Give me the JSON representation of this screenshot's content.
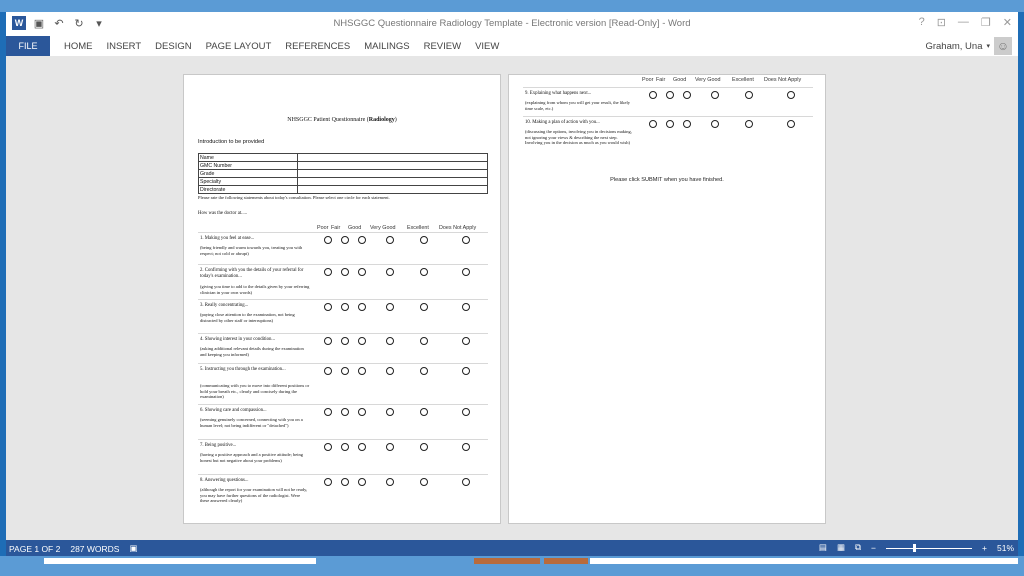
{
  "window": {
    "title": "NHSGGC Questionnaire Radiology Template - Electronic version [Read-Only] - Word",
    "controls": [
      "?",
      "⊡",
      "—",
      "❐",
      "✕"
    ]
  },
  "ribbon": {
    "file": "FILE",
    "tabs": [
      "HOME",
      "INSERT",
      "DESIGN",
      "PAGE LAYOUT",
      "REFERENCES",
      "MAILINGS",
      "REVIEW",
      "VIEW"
    ],
    "user": "Graham, Una"
  },
  "document": {
    "title_prefix": "NHSGGC Patient Questionnaire (",
    "title_bold": "Radiology",
    "title_suffix": ")",
    "intro": "Introduction to be provided",
    "info_fields": [
      "Name",
      "GMC Number",
      "Grade",
      "Specialty",
      "Directorate"
    ],
    "instructions": "Please rate the following statements about today's consultation.  Please select one circle for each statement.",
    "how_was": "How was the doctor at.....",
    "columns": [
      "Poor",
      "Fair",
      "Good",
      "Very Good",
      "Excellent",
      "Does Not Apply"
    ],
    "questions": [
      {
        "text": "1. Making you feel at ease...",
        "sub": "(being friendly and warm towards you, treating you with respect; not cold or abrupt)"
      },
      {
        "text": "2. Confirming with you the details of your referral for today's examination...",
        "sub": "(giving you time to add to the details given by your referring clinician in your own words)"
      },
      {
        "text": "3. Really concentrating...",
        "sub": "(paying close attention to the examination, not being distracted by other staff or interruptions)"
      },
      {
        "text": "4. Showing interest in your condition...",
        "sub": "(asking additional relevant details during the examination and keeping you informed)"
      },
      {
        "text": "5. Instructing you through the examination...",
        "sub": "(communicating with you to move into different positions or hold your breath etc., clearly and concisely during the examination)"
      },
      {
        "text": "6. Showing care and compassion...",
        "sub": "(seeming genuinely concerned, connecting with you on a human level; not being indifferent or \"detached\")"
      },
      {
        "text": "7. Being positive...",
        "sub": "(having a positive approach and a positive attitude; being honest but not negative about your problems)"
      },
      {
        "text": "8. Answering questions...",
        "sub": "(although the report for your examination will not be ready, you may have further questions of the radiologist. Were these answered clearly)"
      },
      {
        "text": "9. Explaining what happens next...",
        "sub": "(explaining from whom you will get your result, the likely time scale, etc.)"
      },
      {
        "text": "10. Making a plan of action with you...",
        "sub": "(discussing the options, involving you in decisions making, not ignoring your views & describing the next step. Involving you in the decision as much as you would wish)"
      }
    ],
    "submit_note": "Please click SUBMIT  when you have finished."
  },
  "status": {
    "page": "PAGE 1 OF 2",
    "words": "287 WORDS",
    "zoom": "51%",
    "zoom_level_fraction": 0.33
  }
}
